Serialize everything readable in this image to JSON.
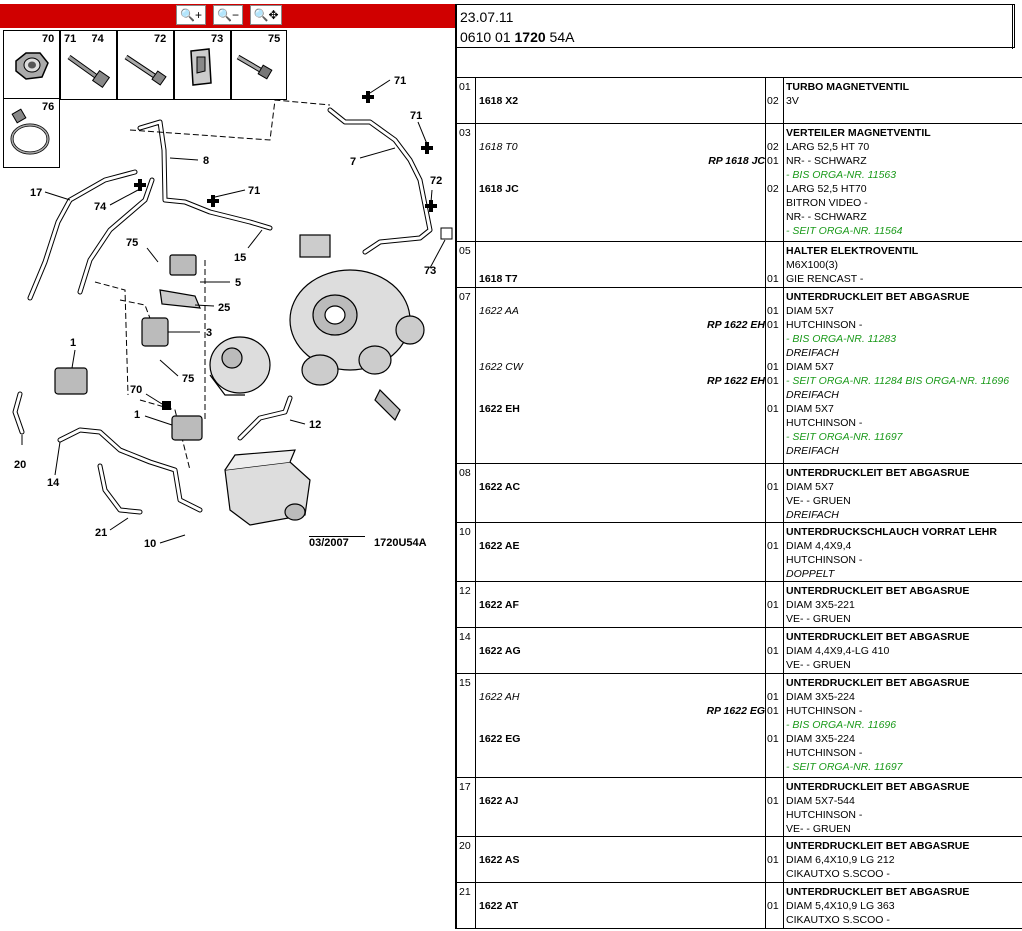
{
  "toolbar": {
    "zoom_in": "🔍+",
    "zoom_out": "🔍−",
    "zoom_move": "🔍✥"
  },
  "parts_box": {
    "items": [
      {
        "nums": "70"
      },
      {
        "nums": "71     74"
      },
      {
        "nums": "72"
      },
      {
        "nums": "73"
      },
      {
        "nums": "75"
      },
      {
        "nums": "76"
      }
    ]
  },
  "diagram": {
    "labels": [
      "71",
      "71",
      "8",
      "71",
      "7",
      "72",
      "17",
      "74",
      "15",
      "73",
      "75",
      "5",
      "25",
      "3",
      "1",
      "75",
      "70",
      "1",
      "12",
      "20",
      "14",
      "21",
      "10"
    ],
    "footer_date": "03/2007",
    "footer_ref": "1720U54A"
  },
  "header": {
    "date": "23.07.11",
    "code_prefix": "0610 01 ",
    "code_bold": "1720",
    "code_suffix": " 54A"
  },
  "rows": [
    {
      "no": "01",
      "height": 46,
      "lines": [
        {
          "ref": "",
          "rp": "",
          "qty": "",
          "desc": "TURBO MAGNETVENTIL",
          "style": "b"
        },
        {
          "ref": "1618 X2",
          "refit": false,
          "rp": "",
          "qty": "02",
          "desc": "3V",
          "style": ""
        }
      ]
    },
    {
      "no": "03",
      "height": 118,
      "lines": [
        {
          "ref": "",
          "rp": "",
          "qty": "",
          "desc": "VERTEILER MAGNETVENTIL",
          "style": "b"
        },
        {
          "ref": "1618 T0",
          "refit": true,
          "rp": "",
          "qty": "02",
          "desc": "LARG 52,5 HT 70",
          "style": ""
        },
        {
          "ref": "",
          "rp": "RP 1618 JC",
          "qty": "01",
          "desc": "NR- - SCHWARZ",
          "style": ""
        },
        {
          "ref": "",
          "rp": "",
          "qty": "",
          "desc": "- BIS ORGA-NR. 11563",
          "style": "g"
        },
        {
          "ref": "1618 JC",
          "refit": false,
          "rp": "",
          "qty": "02",
          "desc": "LARG 52,5 HT70",
          "style": ""
        },
        {
          "ref": "",
          "rp": "",
          "qty": "",
          "desc": "BITRON VIDEO -",
          "style": ""
        },
        {
          "ref": "",
          "rp": "",
          "qty": "",
          "desc": "NR- - SCHWARZ",
          "style": ""
        },
        {
          "ref": "",
          "rp": "",
          "qty": "",
          "desc": "- SEIT ORGA-NR. 11564",
          "style": "g"
        }
      ]
    },
    {
      "no": "05",
      "height": 46,
      "lines": [
        {
          "ref": "",
          "rp": "",
          "qty": "",
          "desc": "HALTER ELEKTROVENTIL",
          "style": "b"
        },
        {
          "ref": "",
          "rp": "",
          "qty": "",
          "desc": "M6X100(3)",
          "style": ""
        },
        {
          "ref": "1618 T7",
          "refit": false,
          "rp": "",
          "qty": "01",
          "desc": "GIE RENCAST -",
          "style": ""
        }
      ]
    },
    {
      "no": "07",
      "height": 176,
      "lines": [
        {
          "ref": "",
          "rp": "",
          "qty": "",
          "desc": "UNTERDRUCKLEIT BET ABGASRUE",
          "style": "b"
        },
        {
          "ref": "1622 AA",
          "refit": true,
          "rp": "",
          "qty": "01",
          "desc": "DIAM 5X7",
          "style": ""
        },
        {
          "ref": "",
          "rp": "RP 1622 EH",
          "qty": "01",
          "desc": "HUTCHINSON -",
          "style": ""
        },
        {
          "ref": "",
          "rp": "",
          "qty": "",
          "desc": "- BIS ORGA-NR. 11283",
          "style": "g"
        },
        {
          "ref": "",
          "rp": "",
          "qty": "",
          "desc": "DREIFACH",
          "style": "it"
        },
        {
          "ref": "1622 CW",
          "refit": true,
          "rp": "",
          "qty": "01",
          "desc": "DIAM 5X7",
          "style": ""
        },
        {
          "ref": "",
          "rp": "RP 1622 EH",
          "qty": "01",
          "desc": "- SEIT ORGA-NR. 11284 BIS ORGA-NR. 11696",
          "style": "g"
        },
        {
          "ref": "",
          "rp": "",
          "qty": "",
          "desc": "DREIFACH",
          "style": "it"
        },
        {
          "ref": "1622 EH",
          "refit": false,
          "rp": "",
          "qty": "01",
          "desc": "DIAM 5X7",
          "style": ""
        },
        {
          "ref": "",
          "rp": "",
          "qty": "",
          "desc": "HUTCHINSON -",
          "style": ""
        },
        {
          "ref": "",
          "rp": "",
          "qty": "",
          "desc": "- SEIT ORGA-NR. 11697",
          "style": "g"
        },
        {
          "ref": "",
          "rp": "",
          "qty": "",
          "desc": "DREIFACH",
          "style": "it"
        }
      ]
    },
    {
      "no": "08",
      "height": 59,
      "lines": [
        {
          "ref": "",
          "rp": "",
          "qty": "",
          "desc": "UNTERDRUCKLEIT BET ABGASRUE",
          "style": "b"
        },
        {
          "ref": "1622 AC",
          "refit": false,
          "rp": "",
          "qty": "01",
          "desc": "DIAM 5X7",
          "style": ""
        },
        {
          "ref": "",
          "rp": "",
          "qty": "",
          "desc": "VE- - GRUEN",
          "style": ""
        },
        {
          "ref": "",
          "rp": "",
          "qty": "",
          "desc": "DREIFACH",
          "style": "it"
        }
      ]
    },
    {
      "no": "10",
      "height": 59,
      "lines": [
        {
          "ref": "",
          "rp": "",
          "qty": "",
          "desc": "UNTERDRUCKSCHLAUCH VORRAT LEHR",
          "style": "b"
        },
        {
          "ref": "1622 AE",
          "refit": false,
          "rp": "",
          "qty": "01",
          "desc": "DIAM 4,4X9,4",
          "style": ""
        },
        {
          "ref": "",
          "rp": "",
          "qty": "",
          "desc": "HUTCHINSON -",
          "style": ""
        },
        {
          "ref": "",
          "rp": "",
          "qty": "",
          "desc": "DOPPELT",
          "style": "it"
        }
      ]
    },
    {
      "no": "12",
      "height": 46,
      "lines": [
        {
          "ref": "",
          "rp": "",
          "qty": "",
          "desc": "UNTERDRUCKLEIT BET ABGASRUE",
          "style": "b"
        },
        {
          "ref": "1622 AF",
          "refit": false,
          "rp": "",
          "qty": "01",
          "desc": "DIAM 3X5-221",
          "style": ""
        },
        {
          "ref": "",
          "rp": "",
          "qty": "",
          "desc": "VE- - GRUEN",
          "style": ""
        }
      ]
    },
    {
      "no": "14",
      "height": 46,
      "lines": [
        {
          "ref": "",
          "rp": "",
          "qty": "",
          "desc": "UNTERDRUCKLEIT BET ABGASRUE",
          "style": "b"
        },
        {
          "ref": "1622 AG",
          "refit": false,
          "rp": "",
          "qty": "01",
          "desc": "DIAM 4,4X9,4-LG 410",
          "style": ""
        },
        {
          "ref": "",
          "rp": "",
          "qty": "",
          "desc": "VE- - GRUEN",
          "style": ""
        }
      ]
    },
    {
      "no": "15",
      "height": 104,
      "lines": [
        {
          "ref": "",
          "rp": "",
          "qty": "",
          "desc": "UNTERDRUCKLEIT BET ABGASRUE",
          "style": "b"
        },
        {
          "ref": "1622 AH",
          "refit": true,
          "rp": "",
          "qty": "01",
          "desc": "DIAM 3X5-224",
          "style": ""
        },
        {
          "ref": "",
          "rp": "RP 1622 EG",
          "qty": "01",
          "desc": "HUTCHINSON -",
          "style": ""
        },
        {
          "ref": "",
          "rp": "",
          "qty": "",
          "desc": "- BIS ORGA-NR. 11696",
          "style": "g"
        },
        {
          "ref": "1622 EG",
          "refit": false,
          "rp": "",
          "qty": "01",
          "desc": "DIAM 3X5-224",
          "style": ""
        },
        {
          "ref": "",
          "rp": "",
          "qty": "",
          "desc": "HUTCHINSON -",
          "style": ""
        },
        {
          "ref": "",
          "rp": "",
          "qty": "",
          "desc": "- SEIT ORGA-NR. 11697",
          "style": "g"
        }
      ]
    },
    {
      "no": "17",
      "height": 59,
      "lines": [
        {
          "ref": "",
          "rp": "",
          "qty": "",
          "desc": "UNTERDRUCKLEIT BET ABGASRUE",
          "style": "b"
        },
        {
          "ref": "1622 AJ",
          "refit": false,
          "rp": "",
          "qty": "01",
          "desc": "DIAM 5X7-544",
          "style": ""
        },
        {
          "ref": "",
          "rp": "",
          "qty": "",
          "desc": "HUTCHINSON -",
          "style": ""
        },
        {
          "ref": "",
          "rp": "",
          "qty": "",
          "desc": "VE- - GRUEN",
          "style": ""
        }
      ]
    },
    {
      "no": "20",
      "height": 46,
      "lines": [
        {
          "ref": "",
          "rp": "",
          "qty": "",
          "desc": "UNTERDRUCKLEIT BET ABGASRUE",
          "style": "b"
        },
        {
          "ref": "1622 AS",
          "refit": false,
          "rp": "",
          "qty": "01",
          "desc": "DIAM 6,4X10,9 LG 212",
          "style": ""
        },
        {
          "ref": "",
          "rp": "",
          "qty": "",
          "desc": "CIKAUTXO S.SCOO -",
          "style": ""
        }
      ]
    },
    {
      "no": "21",
      "height": 46,
      "lines": [
        {
          "ref": "",
          "rp": "",
          "qty": "",
          "desc": "UNTERDRUCKLEIT BET ABGASRUE",
          "style": "b"
        },
        {
          "ref": "1622 AT",
          "refit": false,
          "rp": "",
          "qty": "01",
          "desc": "DIAM 5,4X10,9 LG 363",
          "style": ""
        },
        {
          "ref": "",
          "rp": "",
          "qty": "",
          "desc": "CIKAUTXO S.SCOO -",
          "style": ""
        }
      ]
    }
  ]
}
